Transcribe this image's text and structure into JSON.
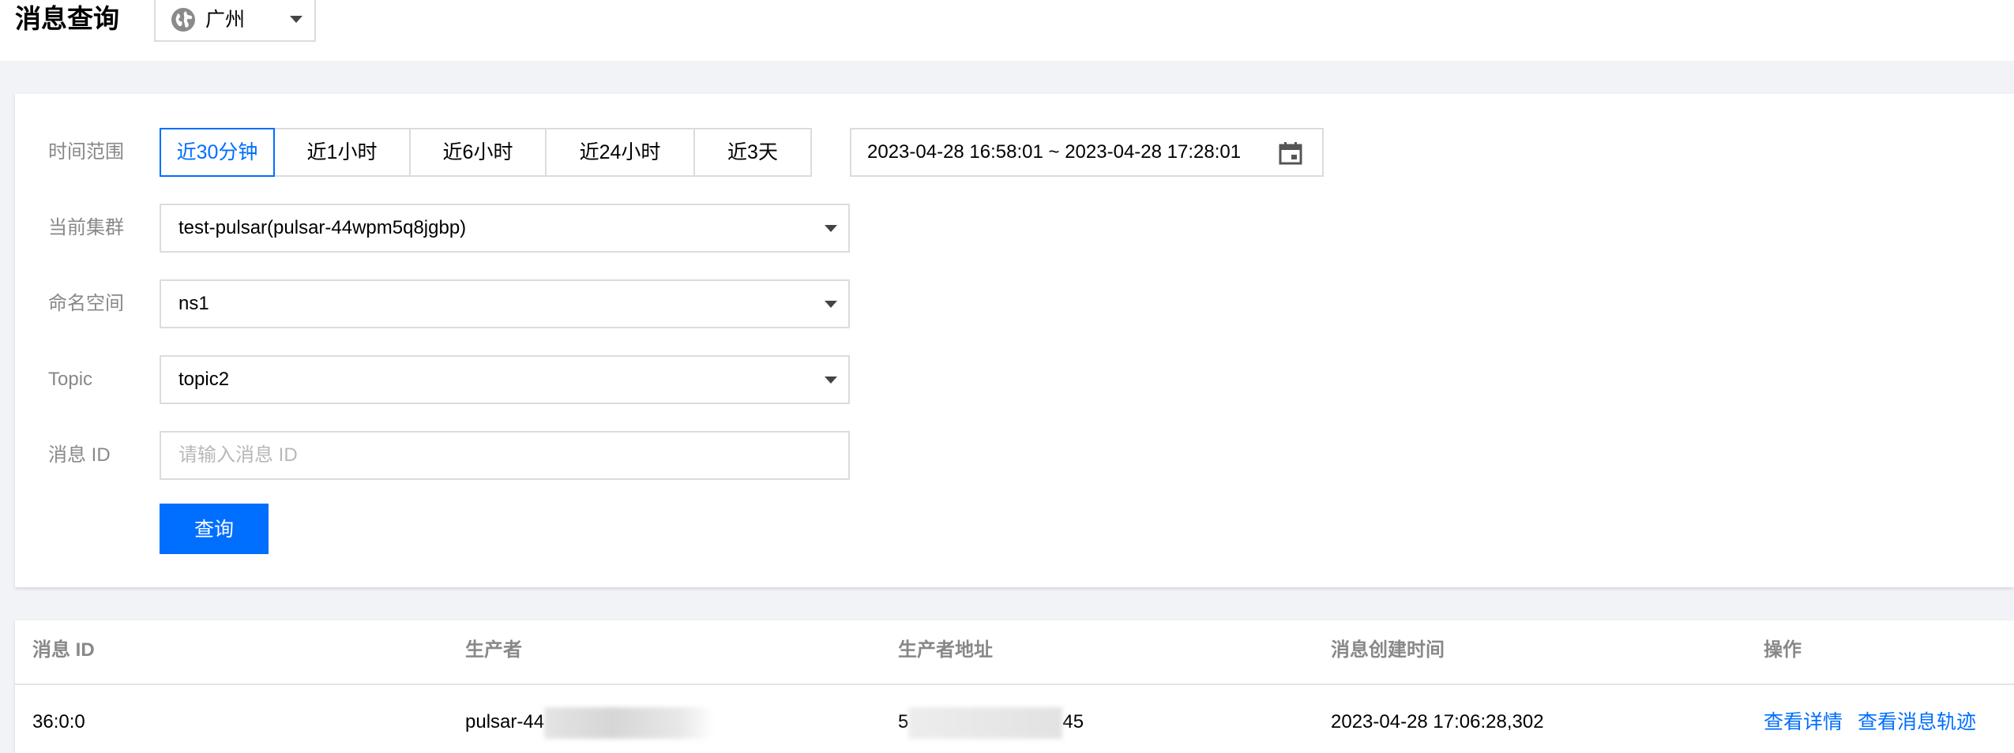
{
  "page": {
    "title": "消息查询",
    "region": "广州"
  },
  "filters": {
    "time_range_label": "时间范围",
    "time_options": [
      "近30分钟",
      "近1小时",
      "近6小时",
      "近24小时",
      "近3天"
    ],
    "time_active": "近30分钟",
    "date_range": "2023-04-28 16:58:01 ~ 2023-04-28 17:28:01",
    "cluster_label": "当前集群",
    "cluster_value": "test-pulsar(pulsar-44wpm5q8jgbp)",
    "namespace_label": "命名空间",
    "namespace_value": "ns1",
    "topic_label": "Topic",
    "topic_value": "topic2",
    "message_id_label": "消息 ID",
    "message_id_placeholder": "请输入消息 ID",
    "query_button": "查询"
  },
  "table": {
    "columns": [
      "消息 ID",
      "生产者",
      "生产者地址",
      "消息创建时间",
      "操作"
    ],
    "rows": [
      {
        "message_id": "36:0:0",
        "producer_prefix": "pulsar-44",
        "address_prefix": "5",
        "address_suffix": "45",
        "created_at": "2023-04-28 17:06:28,302",
        "actions": [
          "查看详情",
          "查看消息轨迹"
        ]
      }
    ]
  },
  "colors": {
    "accent": "#006eff",
    "label_gray": "#888888",
    "border": "#dcdcdc",
    "background": "#f2f3f6"
  },
  "icons": {
    "region": "globe-icon",
    "date": "calendar-icon",
    "dropdown": "caret-down-icon"
  }
}
